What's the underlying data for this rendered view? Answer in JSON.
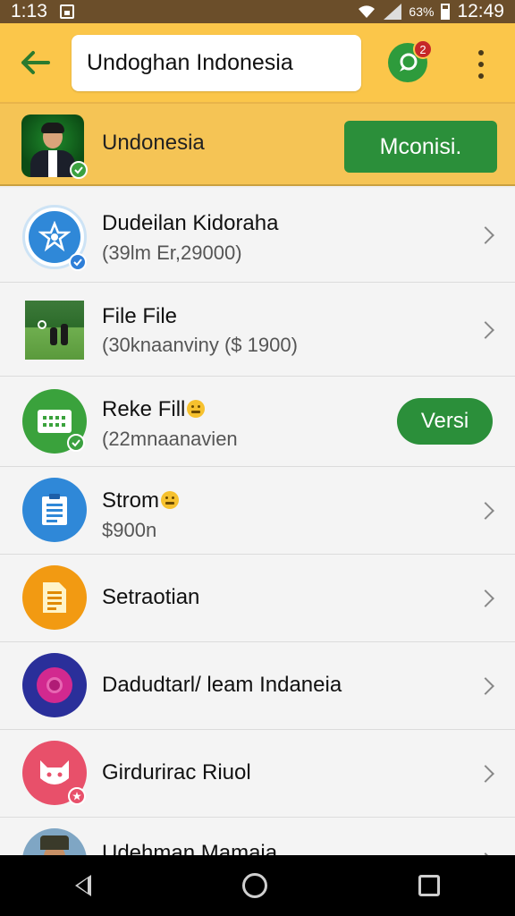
{
  "status_bar": {
    "time_left": "1:13",
    "battery_pct": "63%",
    "time_right": "12:49"
  },
  "app_bar": {
    "search_value": "Undoghan Indonesia",
    "chat_badge_count": "2",
    "icons": [
      "back-arrow-icon",
      "chat-icon",
      "more-vert-icon"
    ]
  },
  "banner": {
    "name": "Undonesia",
    "button_label": "Mconisi."
  },
  "list": [
    {
      "title": "Dudeilan Kidoraha",
      "subtitle": "(39lm Er,29000)",
      "icon": "star-badge-icon",
      "action": "chevron"
    },
    {
      "title": "File File",
      "subtitle": "(30knaanviny ($ 1900)",
      "icon": "photo-thumbnail",
      "action": "chevron"
    },
    {
      "title": "Reke Fill",
      "subtitle": "(22mnaanavien",
      "icon": "keyboard-icon",
      "action": "button",
      "button_label": "Versi"
    },
    {
      "title": "Strom",
      "subtitle": "$900n",
      "icon": "clipboard-icon",
      "action": "chevron"
    },
    {
      "title": "Setraotian",
      "subtitle": "",
      "icon": "document-icon",
      "action": "chevron"
    },
    {
      "title": "Dadudtarl/ leam Indaneia",
      "subtitle": "",
      "icon": "record-icon",
      "action": "chevron"
    },
    {
      "title": "Girdurirac Riuol",
      "subtitle": "",
      "icon": "cat-face-icon",
      "action": "chevron"
    },
    {
      "title": "Udehman Mamaia",
      "subtitle": "",
      "icon": "person-avatar",
      "action": "chevron"
    }
  ],
  "colors": {
    "accent_yellow": "#fbc64a",
    "accent_green": "#2b8f3a",
    "status_brown": "#6b4e2a"
  }
}
